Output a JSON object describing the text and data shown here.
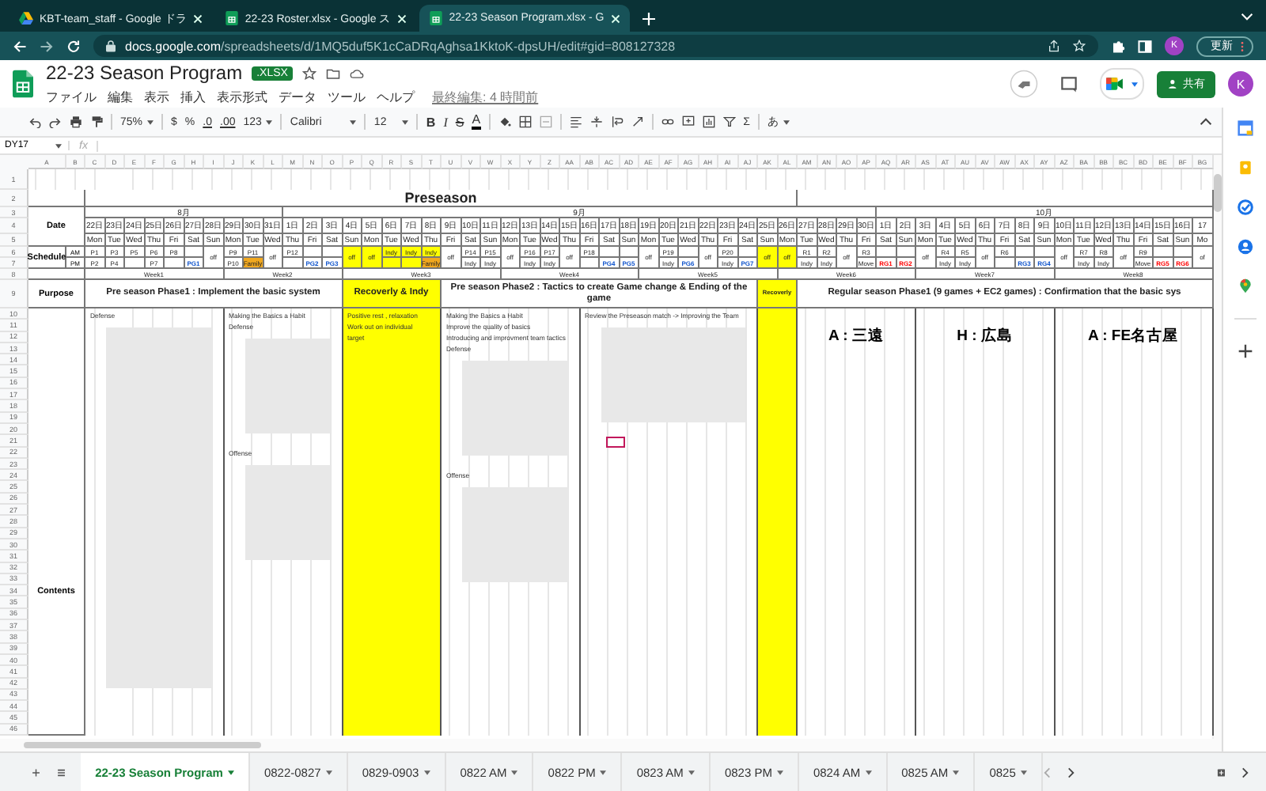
{
  "browser": {
    "tabs": [
      {
        "title": "KBT-team_staff - Google ドラ",
        "kind": "drive",
        "selected": false
      },
      {
        "title": "22-23 Roster.xlsx - Google ス",
        "kind": "sheets",
        "selected": false
      },
      {
        "title": "22-23 Season Program.xlsx - G",
        "kind": "sheets",
        "selected": true
      }
    ],
    "url_host": "docs.google.com",
    "url_path": "/spreadsheets/d/1MQ5duf5K1cCaDRqAghsa1KktoK-dpsUH/edit#gid=808127328",
    "avatar": "K",
    "update_button": "更新"
  },
  "document": {
    "title": "22-23 Season Program",
    "badge": ".XLSX",
    "menu": [
      "ファイル",
      "編集",
      "表示",
      "挿入",
      "表示形式",
      "データ",
      "ツール",
      "ヘルプ"
    ],
    "last_edit": "最終編集: 4 時間前",
    "share_button": "共有",
    "avatar": "K"
  },
  "toolbar": {
    "zoom": "75%",
    "currency": "$",
    "percent": "%",
    "decrease_decimals": ".0",
    "increase_decimals": ".00",
    "number_format": "123",
    "font": "Calibri",
    "font_size": "12",
    "bold": "B",
    "italic": "I",
    "strikethrough": "S",
    "text_color": "A",
    "functions": "Σ",
    "input_tools": "あ"
  },
  "formula_bar": {
    "cell_ref": "DY17",
    "fx": "fx"
  },
  "sheet": {
    "columns": [
      "A",
      "B",
      "C",
      "D",
      "E",
      "F",
      "G",
      "H",
      "I",
      "J",
      "K",
      "L",
      "M",
      "N",
      "O",
      "P",
      "Q",
      "R",
      "S",
      "T",
      "U",
      "V",
      "W",
      "X",
      "Y",
      "Z",
      "AA",
      "AB",
      "AC",
      "AD",
      "AE",
      "AF",
      "AG",
      "AH",
      "AI",
      "AJ",
      "AK",
      "AL",
      "AM",
      "AN",
      "AO",
      "AP",
      "AQ",
      "AR",
      "AS",
      "AT",
      "AU",
      "AV",
      "AW",
      "AX",
      "AY",
      "AZ",
      "BA",
      "BB",
      "BC",
      "BD",
      "BE",
      "BF",
      "BG"
    ],
    "rows": [
      "1",
      "2",
      "3",
      "4",
      "5",
      "6",
      "7",
      "8",
      "9",
      "10",
      "11",
      "12",
      "13",
      "14",
      "15",
      "16",
      "17",
      "18",
      "19",
      "20",
      "21",
      "22",
      "23",
      "24",
      "25",
      "26",
      "27",
      "28",
      "29",
      "30",
      "31",
      "32",
      "33",
      "34",
      "35",
      "36",
      "37",
      "38",
      "39",
      "40",
      "41",
      "42",
      "43",
      "44",
      "45",
      "46"
    ],
    "labels": {
      "date": "Date",
      "schedule": "Schedule",
      "am": "AM",
      "pm": "PM",
      "purpose": "Purpose",
      "contents": "Contents"
    },
    "days": [
      {
        "date": "22日",
        "weekday": "Mon",
        "highlight": false,
        "month": "8月",
        "week": "Week1",
        "season": "Preseason",
        "phase": "Pre season Phase1 : Implement the basic system",
        "am": "P1",
        "pm": "P2",
        "content": [
          {
            "kind": "text",
            "text": "Defense"
          },
          {
            "kind": "tall-placeholder"
          }
        ]
      },
      {
        "date": "23日",
        "weekday": "Tue",
        "highlight": false,
        "am": "P3",
        "pm": "P4"
      },
      {
        "date": "24日",
        "weekday": "Wed",
        "highlight": false,
        "am": "P5"
      },
      {
        "date": "25日",
        "weekday": "Thu",
        "highlight": false,
        "am": "P6",
        "pm": "P7"
      },
      {
        "date": "26日",
        "weekday": "Fri",
        "highlight": false,
        "am": "P8"
      },
      {
        "date": "27日",
        "weekday": "Sat",
        "highlight": false,
        "pm": {
          "text": "PG1",
          "kind": "text",
          "color": "#1155cc"
        }
      },
      {
        "date": "28日",
        "weekday": "Sun",
        "highlight": false,
        "all": "off"
      },
      {
        "date": "29日",
        "weekday": "Mon",
        "highlight": false,
        "week": "Week2",
        "am": "P9",
        "pm": "P10",
        "content": [
          {
            "kind": "text",
            "text": "Making the Basics a Habit"
          },
          {
            "kind": "text",
            "text": "Defense"
          },
          {
            "kind": "placeholder"
          },
          {
            "kind": "text",
            "text": "Offense"
          },
          {
            "kind": "placeholder"
          }
        ]
      },
      {
        "date": "30日",
        "weekday": "Tue",
        "highlight": false,
        "am": "P11",
        "pm": {
          "text": "Family",
          "kind": "fill",
          "color": "#f1a81f"
        }
      },
      {
        "date": "31日",
        "weekday": "Wed",
        "highlight": false,
        "all": "off"
      },
      {
        "date": "1日",
        "weekday": "Thu",
        "highlight": false,
        "month": "9月",
        "am": "P12"
      },
      {
        "date": "2日",
        "weekday": "Fri",
        "highlight": false,
        "pm": {
          "text": "PG2",
          "kind": "text",
          "color": "#1155cc"
        }
      },
      {
        "date": "3日",
        "weekday": "Sat",
        "highlight": false,
        "pm": {
          "text": "PG3",
          "kind": "text",
          "color": "#1155cc"
        }
      },
      {
        "date": "4日",
        "weekday": "Sun",
        "highlight": true,
        "week": "Week3",
        "phase": "Recoverly & Indy",
        "all": "off",
        "content": [
          {
            "kind": "text",
            "text": "Positive rest , relaxation"
          },
          {
            "kind": "text",
            "text": "Work out on individual"
          },
          {
            "kind": "text",
            "text": "target"
          }
        ]
      },
      {
        "date": "5日",
        "weekday": "Mon",
        "highlight": true,
        "all": "off"
      },
      {
        "date": "6日",
        "weekday": "Tue",
        "highlight": true,
        "am": "Indy"
      },
      {
        "date": "7日",
        "weekday": "Wed",
        "highlight": true,
        "am": "Indy"
      },
      {
        "date": "8日",
        "weekday": "Thu",
        "highlight": true,
        "am": "Indy",
        "pm": {
          "text": "Family",
          "kind": "fill",
          "color": "#f1a81f"
        }
      },
      {
        "date": "9日",
        "weekday": "Fri",
        "highlight": false,
        "phase": "Pre season Phase2 : Tactics to create Game change & Ending of the game",
        "all": "off",
        "content": [
          {
            "kind": "text",
            "text": "Making the Basics a Habit"
          },
          {
            "kind": "text",
            "text": "Improve the quality of basics"
          },
          {
            "kind": "text",
            "text": "Introducing and improvment team tactics"
          },
          {
            "kind": "text",
            "text": "Defense"
          },
          {
            "kind": "placeholder"
          },
          {
            "kind": "text",
            "text": "Offense"
          },
          {
            "kind": "placeholder"
          }
        ]
      },
      {
        "date": "10日",
        "weekday": "Sat",
        "highlight": false,
        "am": "P14",
        "pm": "Indy"
      },
      {
        "date": "11日",
        "weekday": "Sun",
        "highlight": false,
        "am": "P15",
        "pm": "Indy"
      },
      {
        "date": "12日",
        "weekday": "Mon",
        "highlight": false,
        "week": "Week4",
        "all": "off"
      },
      {
        "date": "13日",
        "weekday": "Tue",
        "highlight": false,
        "am": "P16",
        "pm": "Indy"
      },
      {
        "date": "14日",
        "weekday": "Wed",
        "highlight": false,
        "am": "P17",
        "pm": "Indy"
      },
      {
        "date": "15日",
        "weekday": "Thu",
        "highlight": false,
        "all": "off"
      },
      {
        "date": "16日",
        "weekday": "Fri",
        "highlight": false,
        "am": "P18",
        "content": [
          {
            "kind": "text",
            "text": "Review the Preseason match -> Improving the Team"
          },
          {
            "kind": "placeholder"
          }
        ]
      },
      {
        "date": "17日",
        "weekday": "Sat",
        "highlight": false,
        "pm": {
          "text": "PG4",
          "kind": "text",
          "color": "#1155cc"
        }
      },
      {
        "date": "18日",
        "weekday": "Sun",
        "highlight": false,
        "pm": {
          "text": "PG5",
          "kind": "text",
          "color": "#1155cc"
        }
      },
      {
        "date": "19日",
        "weekday": "Mon",
        "highlight": false,
        "week": "Week5",
        "all": "off"
      },
      {
        "date": "20日",
        "weekday": "Tue",
        "highlight": false,
        "am": "P19",
        "pm": "Indy"
      },
      {
        "date": "21日",
        "weekday": "Wed",
        "highlight": false,
        "pm": {
          "text": "PG6",
          "kind": "text",
          "color": "#1155cc"
        }
      },
      {
        "date": "22日",
        "weekday": "Thu",
        "highlight": false,
        "all": "off"
      },
      {
        "date": "23日",
        "weekday": "Fri",
        "highlight": false,
        "am": "P20",
        "pm": "Indy"
      },
      {
        "date": "24日",
        "weekday": "Sat",
        "highlight": false,
        "pm": {
          "text": "PG7",
          "kind": "text",
          "color": "#1155cc"
        }
      },
      {
        "date": "25日",
        "weekday": "Sun",
        "highlight": true,
        "phase": "Recoverly",
        "all": "off"
      },
      {
        "date": "26日",
        "weekday": "Mon",
        "highlight": true,
        "week": "Week6",
        "all": "off"
      },
      {
        "date": "27日",
        "weekday": "Tue",
        "highlight": false,
        "phase": "Regular season Phase1 (9 games + EC2 games) : Confirmation that the basic sys",
        "am": "R1",
        "pm": "Indy",
        "content": [
          {
            "kind": "heading",
            "text": "A : 三遠"
          }
        ]
      },
      {
        "date": "28日",
        "weekday": "Wed",
        "highlight": false,
        "am": "R2",
        "pm": "Indy"
      },
      {
        "date": "29日",
        "weekday": "Thu",
        "highlight": false,
        "all": "off"
      },
      {
        "date": "30日",
        "weekday": "Fri",
        "highlight": false,
        "am": "R3",
        "pm": "Move"
      },
      {
        "date": "1日",
        "weekday": "Sat",
        "highlight": false,
        "month": "10月",
        "pm": {
          "text": "RG1",
          "kind": "text",
          "color": "#ff0000"
        }
      },
      {
        "date": "2日",
        "weekday": "Sun",
        "highlight": false,
        "pm": {
          "text": "RG2",
          "kind": "text",
          "color": "#ff0000"
        }
      },
      {
        "date": "3日",
        "weekday": "Mon",
        "highlight": false,
        "week": "Week7",
        "all": "off",
        "content": [
          {
            "kind": "heading",
            "text": "H : 広島"
          }
        ]
      },
      {
        "date": "4日",
        "weekday": "Tue",
        "highlight": false,
        "am": "R4",
        "pm": "Indy"
      },
      {
        "date": "5日",
        "weekday": "Wed",
        "highlight": false,
        "am": "R5",
        "pm": "Indy"
      },
      {
        "date": "6日",
        "weekday": "Thu",
        "highlight": false,
        "all": "off"
      },
      {
        "date": "7日",
        "weekday": "Fri",
        "highlight": false,
        "am": "R6"
      },
      {
        "date": "8日",
        "weekday": "Sat",
        "highlight": false,
        "pm": {
          "text": "RG3",
          "kind": "text",
          "color": "#1155cc"
        }
      },
      {
        "date": "9日",
        "weekday": "Sun",
        "highlight": false,
        "pm": {
          "text": "RG4",
          "kind": "text",
          "color": "#1155cc"
        }
      },
      {
        "date": "10日",
        "weekday": "Mon",
        "highlight": false,
        "week": "Week8",
        "all": "off",
        "content": [
          {
            "kind": "heading",
            "text": "A : FE名古屋"
          }
        ]
      },
      {
        "date": "11日",
        "weekday": "Tue",
        "highlight": false,
        "am": "R7",
        "pm": "Indy"
      },
      {
        "date": "12日",
        "weekday": "Wed",
        "highlight": false,
        "am": "R8",
        "pm": "Indy"
      },
      {
        "date": "13日",
        "weekday": "Thu",
        "highlight": false,
        "all": "off"
      },
      {
        "date": "14日",
        "weekday": "Fri",
        "highlight": false,
        "am": "R9",
        "pm": "Move"
      },
      {
        "date": "15日",
        "weekday": "Sat",
        "highlight": false,
        "pm": {
          "text": "RG5",
          "kind": "text",
          "color": "#ff0000"
        }
      },
      {
        "date": "16日",
        "weekday": "Sun",
        "highlight": false,
        "pm": {
          "text": "RG6",
          "kind": "text",
          "color": "#ff0000"
        }
      },
      {
        "date": "17",
        "weekday": "Mo",
        "highlight": false,
        "all": "of"
      }
    ]
  },
  "sheet_tabs": [
    {
      "label": "22-23 Season Program",
      "selected": true
    },
    {
      "label": "0822-0827",
      "selected": false
    },
    {
      "label": "0829-0903",
      "selected": false
    },
    {
      "label": "0822 AM",
      "selected": false
    },
    {
      "label": "0822 PM",
      "selected": false
    },
    {
      "label": "0823 AM",
      "selected": false
    },
    {
      "label": "0823 PM",
      "selected": false
    },
    {
      "label": "0824 AM",
      "selected": false
    },
    {
      "label": "0825 AM",
      "selected": false
    },
    {
      "label": "0825",
      "selected": false
    }
  ]
}
